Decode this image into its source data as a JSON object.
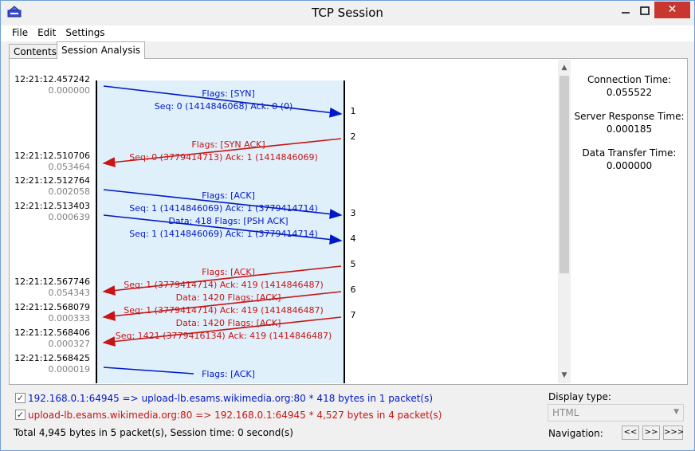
{
  "window": {
    "title": "TCP Session"
  },
  "menu": [
    "File",
    "Edit",
    "Settings"
  ],
  "tabs": [
    "Contents",
    "Session Analysis"
  ],
  "colors": {
    "client": "#0018c8",
    "server": "#c81414",
    "lane_bg": "#e0f0fb"
  },
  "timeline": [
    {
      "time": "12:21:12.457242",
      "delta": "0.000000"
    },
    {
      "time": "12:21:12.510706",
      "delta": "0.053464"
    },
    {
      "time": "12:21:12.512764",
      "delta": "0.002058"
    },
    {
      "time": "12:21:12.513403",
      "delta": "0.000639"
    },
    {
      "time": "12:21:12.567746",
      "delta": "0.054343"
    },
    {
      "time": "12:21:12.568079",
      "delta": "0.000333"
    },
    {
      "time": "12:21:12.568406",
      "delta": "0.000327"
    },
    {
      "time": "12:21:12.568425",
      "delta": "0.000019"
    }
  ],
  "packets": [
    {
      "dir": "c2s",
      "flags": "Flags: [SYN]",
      "seq": "Seq: 0 (1414846068) Ack: 0 (0)",
      "num": "1"
    },
    {
      "dir": "s2c",
      "flags": "Flags: [SYN ACK]",
      "seq": "Seq: 0 (3779414713) Ack: 1 (1414846069)",
      "num": "2"
    },
    {
      "dir": "c2s",
      "flags": "Flags: [ACK]",
      "seq": "Seq: 1 (1414846069) Ack: 1 (3779414714)",
      "num": "3"
    },
    {
      "dir": "c2s",
      "flags": "Data: 418 Flags: [PSH ACK]",
      "seq": "Seq: 1 (1414846069) Ack: 1 (3779414714)",
      "num": "4"
    },
    {
      "dir": "s2c",
      "flags": "Flags: [ACK]",
      "seq": "Seq: 1 (3779414714) Ack: 419 (1414846487)",
      "num": "5"
    },
    {
      "dir": "s2c",
      "flags": "Data: 1420 Flags: [ACK]",
      "seq": "Seq: 1 (3779414714) Ack: 419 (1414846487)",
      "num": "6"
    },
    {
      "dir": "s2c",
      "flags": "Data: 1420 Flags: [ACK]",
      "seq": "Seq: 1421 (3779416134) Ack: 419 (1414846487)",
      "num": "7"
    },
    {
      "dir": "c2s",
      "flags": "Flags: [ACK]",
      "seq": "",
      "num": ""
    }
  ],
  "stats": {
    "connection_label": "Connection Time:",
    "connection_value": "0.055522",
    "server_label": "Server Response Time:",
    "server_value": "0.000185",
    "transfer_label": "Data Transfer Time:",
    "transfer_value": "0.000000"
  },
  "footer": {
    "line1": "192.168.0.1:64945 => upload-lb.esams.wikimedia.org:80 * 418 bytes in 1 packet(s)",
    "line2": "upload-lb.esams.wikimedia.org:80 => 192.168.0.1:64945 * 4,527 bytes in 4 packet(s)",
    "line3": "Total 4,945 bytes in 5 packet(s), Session time: 0 second(s)",
    "display_label": "Display type:",
    "display_value": "HTML",
    "nav_label": "Navigation:",
    "nav_buttons": [
      "<<",
      ">>",
      ">>>"
    ]
  }
}
